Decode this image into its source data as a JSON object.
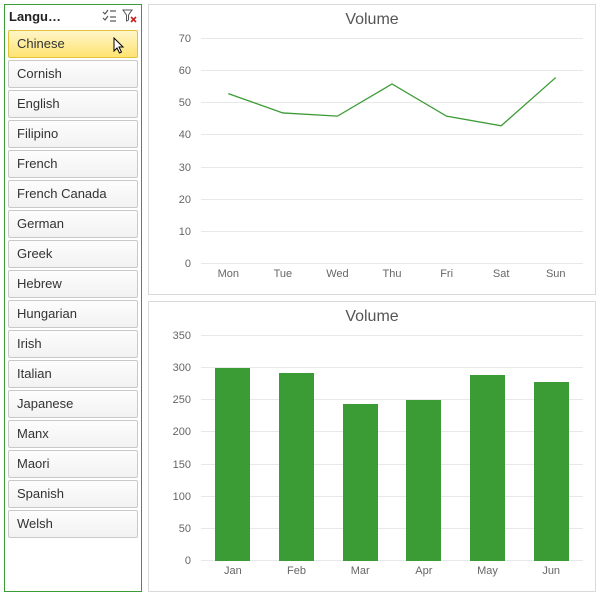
{
  "slicer": {
    "title": "Langu…",
    "multiselect_icon": "multiselect-icon",
    "clearfilter_icon": "clearfilter-icon",
    "items": [
      {
        "label": "Chinese",
        "selected": true
      },
      {
        "label": "Cornish",
        "selected": false
      },
      {
        "label": "English",
        "selected": false
      },
      {
        "label": "Filipino",
        "selected": false
      },
      {
        "label": "French",
        "selected": false
      },
      {
        "label": "French Canada",
        "selected": false
      },
      {
        "label": "German",
        "selected": false
      },
      {
        "label": "Greek",
        "selected": false
      },
      {
        "label": "Hebrew",
        "selected": false
      },
      {
        "label": "Hungarian",
        "selected": false
      },
      {
        "label": "Irish",
        "selected": false
      },
      {
        "label": "Italian",
        "selected": false
      },
      {
        "label": "Japanese",
        "selected": false
      },
      {
        "label": "Manx",
        "selected": false
      },
      {
        "label": "Maori",
        "selected": false
      },
      {
        "label": "Spanish",
        "selected": false
      },
      {
        "label": "Welsh",
        "selected": false
      }
    ]
  },
  "chart_data": [
    {
      "type": "line",
      "title": "Volume",
      "categories": [
        "Mon",
        "Tue",
        "Wed",
        "Thu",
        "Fri",
        "Sat",
        "Sun"
      ],
      "values": [
        53,
        47,
        46,
        56,
        46,
        43,
        58
      ],
      "ylim": [
        0,
        70
      ],
      "y_ticks": [
        0,
        10,
        20,
        30,
        40,
        50,
        60,
        70
      ],
      "color": "#3b9b34"
    },
    {
      "type": "bar",
      "title": "Volume",
      "categories": [
        "Jan",
        "Feb",
        "Mar",
        "Apr",
        "May",
        "Jun"
      ],
      "values": [
        300,
        292,
        245,
        250,
        290,
        278
      ],
      "ylim": [
        0,
        350
      ],
      "y_ticks": [
        0,
        50,
        100,
        150,
        200,
        250,
        300,
        350
      ],
      "color": "#3b9b34"
    }
  ]
}
